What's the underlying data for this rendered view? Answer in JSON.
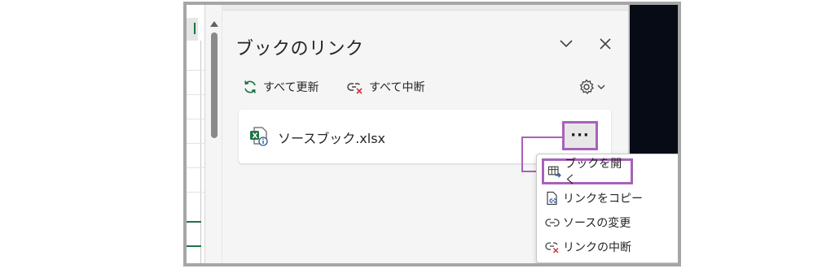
{
  "panel": {
    "title": "ブックのリンク",
    "collapse_icon": "chevron-down-icon",
    "close_icon": "close-icon"
  },
  "toolbar": {
    "refresh_all_label": "すべて更新",
    "break_all_label": "すべて中断",
    "settings_icon": "gear-icon"
  },
  "link_card": {
    "file_name": "ソースブック.xlsx",
    "more_label": "···"
  },
  "context_menu": {
    "items": [
      {
        "label": "ブックを開く",
        "icon": "open-workbook-icon"
      },
      {
        "label": "リンクをコピー",
        "icon": "copy-link-icon"
      },
      {
        "label": "ソースの変更",
        "icon": "change-source-icon"
      },
      {
        "label": "リンクの中断",
        "icon": "break-link-icon"
      }
    ]
  },
  "colors": {
    "highlight": "#a961ba",
    "refresh_icon": "#1e7145",
    "break_icon_red": "#d13438",
    "excel_green": "#217346"
  }
}
